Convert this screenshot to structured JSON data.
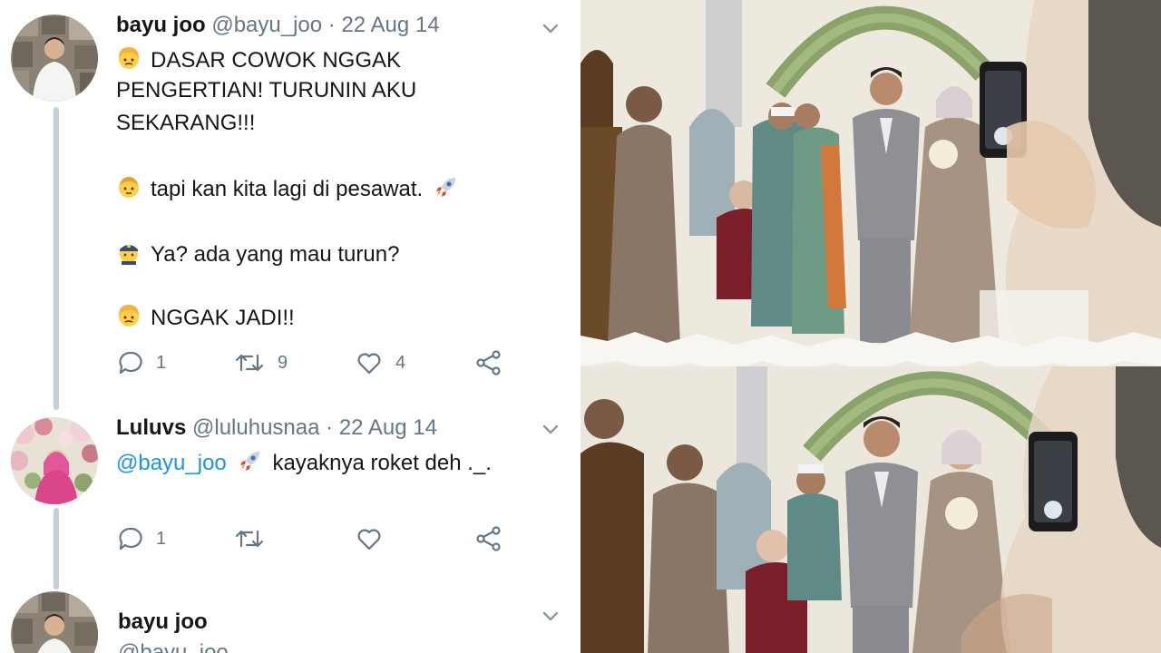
{
  "tweets": [
    {
      "author": "bayu joo",
      "handle": "@bayu_joo",
      "date": "22 Aug 14",
      "lines": [
        {
          "emoji": "angry-blonde-emoji",
          "text": "DASAR COWOK NGGAK"
        },
        {
          "emoji": "",
          "text": "PENGERTIAN! TURUNIN AKU"
        },
        {
          "emoji": "",
          "text": "SEKARANG!!!"
        },
        {
          "emoji": "man-emoji",
          "text": "tapi kan kita lagi di pesawat."
        },
        {
          "emoji": "police-officer-emoji",
          "text": "Ya? ada yang mau turun?"
        },
        {
          "emoji": "angry-blonde-emoji",
          "text": "NGGAK JADI!!"
        }
      ],
      "replies": "1",
      "retweets": "9",
      "likes": "4"
    },
    {
      "author": "Luluvs",
      "handle": "@luluhusnaa",
      "date": "22 Aug 14",
      "mention": "@bayu_joo",
      "text": "kayaknya roket deh ._.",
      "replies": "1",
      "retweets": "",
      "likes": ""
    },
    {
      "author": "bayu joo",
      "handle": "@bayu_joo"
    }
  ],
  "separator": " · ",
  "icons": {
    "reply": "reply-icon",
    "retweet": "retweet-icon",
    "like": "heart-icon",
    "share": "share-icon",
    "more": "chevron-down-icon",
    "rocket": "rocket-emoji"
  },
  "colors": {
    "text": "#14171a",
    "muted": "#657786",
    "link": "#1b95e0",
    "thread": "#c4cfd6"
  },
  "photos": [
    "wedding-photo-top",
    "wedding-photo-bottom"
  ]
}
